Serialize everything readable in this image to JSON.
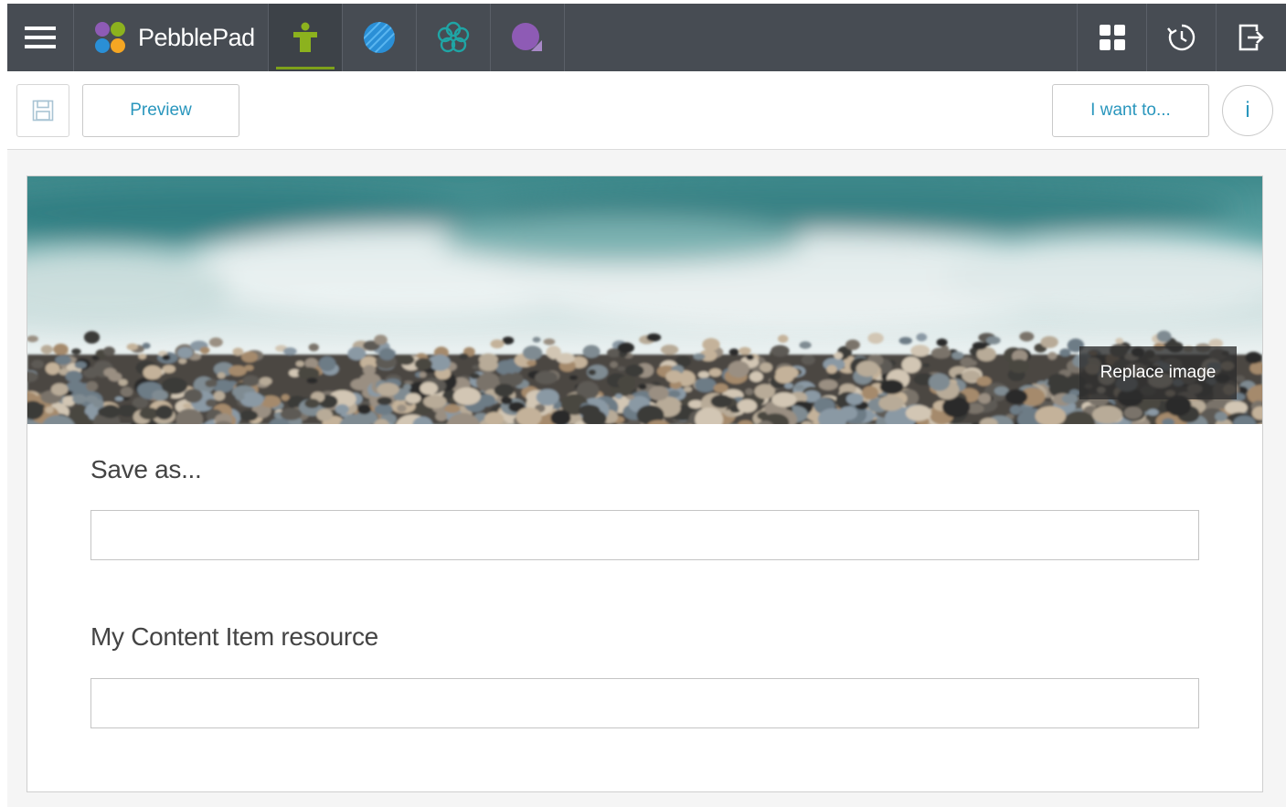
{
  "app": {
    "brand": "PebblePad"
  },
  "topbar": {
    "menu_icon": "hamburger-menu-icon",
    "apps": [
      {
        "name": "asset-store-icon",
        "color": "#8cb21e",
        "active": true
      },
      {
        "name": "atlas-icon",
        "color": "#2a8fd6",
        "active": false
      },
      {
        "name": "flourish-icon",
        "color": "#1fa5a5",
        "active": false
      },
      {
        "name": "pebblepad-purple-icon",
        "color": "#8e5bb5",
        "active": false
      }
    ],
    "right": [
      "apps-grid-icon",
      "history-icon",
      "logout-icon"
    ]
  },
  "toolbar": {
    "save_icon": "floppy-disk-icon",
    "preview_label": "Preview",
    "iwant_label": "I want to...",
    "info_label": "i"
  },
  "banner": {
    "replace_label": "Replace image"
  },
  "form": {
    "save_as_label": "Save as...",
    "save_as_value": "",
    "resource_label": "My Content Item resource",
    "resource_value": ""
  },
  "colors": {
    "topbar": "#474c53",
    "accent": "#2996bd",
    "active_underline": "#7ea11a"
  }
}
